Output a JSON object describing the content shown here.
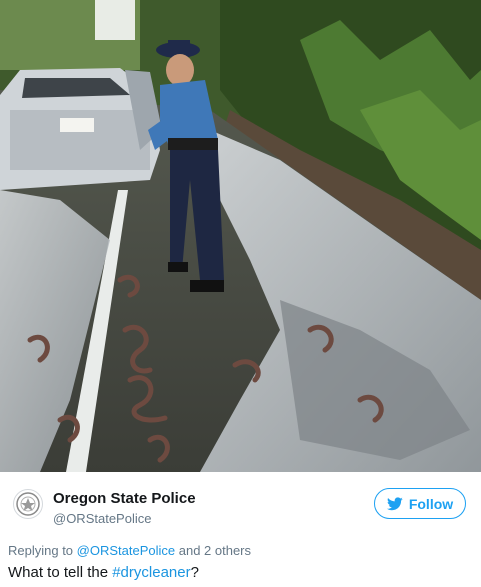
{
  "account": {
    "display_name": "Oregon State Police",
    "handle": "@ORStatePolice",
    "avatar_icon": "police-badge-icon"
  },
  "follow_button": {
    "label": "Follow",
    "icon": "twitter-bird-icon"
  },
  "reply": {
    "prefix": "Replying to ",
    "mention": "@ORStatePolice",
    "suffix": " and 2 others"
  },
  "tweet": {
    "text_before": "What to tell the ",
    "hashtag": "#drycleaner",
    "text_after": "?"
  },
  "colors": {
    "accent": "#1da1f2",
    "link": "#1b95e0",
    "name": "#14171a",
    "muted": "#657786"
  }
}
